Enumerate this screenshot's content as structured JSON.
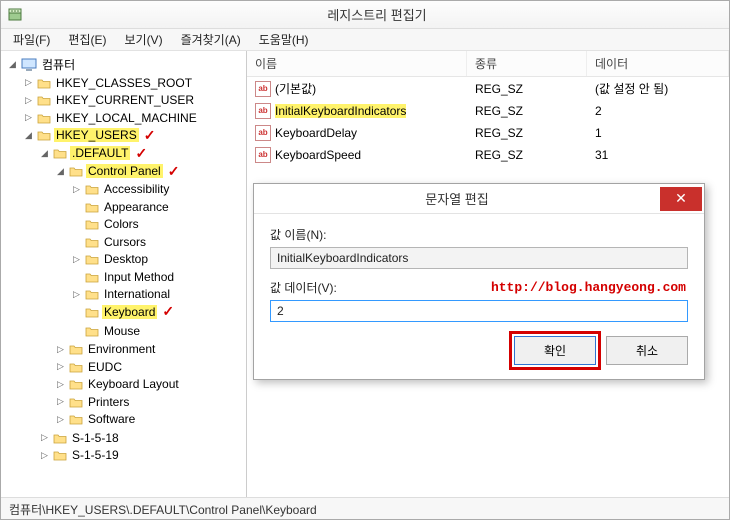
{
  "window": {
    "title": "레지스트리 편집기"
  },
  "menu": {
    "file": "파일(F)",
    "edit": "편집(E)",
    "view": "보기(V)",
    "favorites": "즐겨찾기(A)",
    "help": "도움말(H)"
  },
  "tree": {
    "root": "컴퓨터",
    "hcr": "HKEY_CLASSES_ROOT",
    "hcu": "HKEY_CURRENT_USER",
    "hlm": "HKEY_LOCAL_MACHINE",
    "hku": "HKEY_USERS",
    "def": ".DEFAULT",
    "cpl": "Control Panel",
    "cpl_items": {
      "accessibility": "Accessibility",
      "appearance": "Appearance",
      "colors": "Colors",
      "cursors": "Cursors",
      "desktop": "Desktop",
      "input_method": "Input Method",
      "international": "International",
      "keyboard": "Keyboard",
      "mouse": "Mouse"
    },
    "def_siblings": {
      "environment": "Environment",
      "eudc": "EUDC",
      "keyboard_layout": "Keyboard Layout",
      "printers": "Printers",
      "software": "Software"
    },
    "s1518": "S-1-5-18",
    "s1519": "S-1-5-19"
  },
  "list": {
    "cols": {
      "name": "이름",
      "type": "종류",
      "data": "데이터"
    },
    "rows": [
      {
        "name": "(기본값)",
        "type": "REG_SZ",
        "data": "(값 설정 안 됨)",
        "highlight": false
      },
      {
        "name": "InitialKeyboardIndicators",
        "type": "REG_SZ",
        "data": "2",
        "highlight": true
      },
      {
        "name": "KeyboardDelay",
        "type": "REG_SZ",
        "data": "1",
        "highlight": false
      },
      {
        "name": "KeyboardSpeed",
        "type": "REG_SZ",
        "data": "31",
        "highlight": false
      }
    ]
  },
  "dialog": {
    "title": "문자열 편집",
    "name_label": "값 이름(N):",
    "name_value": "InitialKeyboardIndicators",
    "data_label": "값 데이터(V):",
    "data_value": "2",
    "ok": "확인",
    "cancel": "취소",
    "watermark": "http://blog.hangyeong.com"
  },
  "statusbar": "컴퓨터\\HKEY_USERS\\.DEFAULT\\Control Panel\\Keyboard"
}
